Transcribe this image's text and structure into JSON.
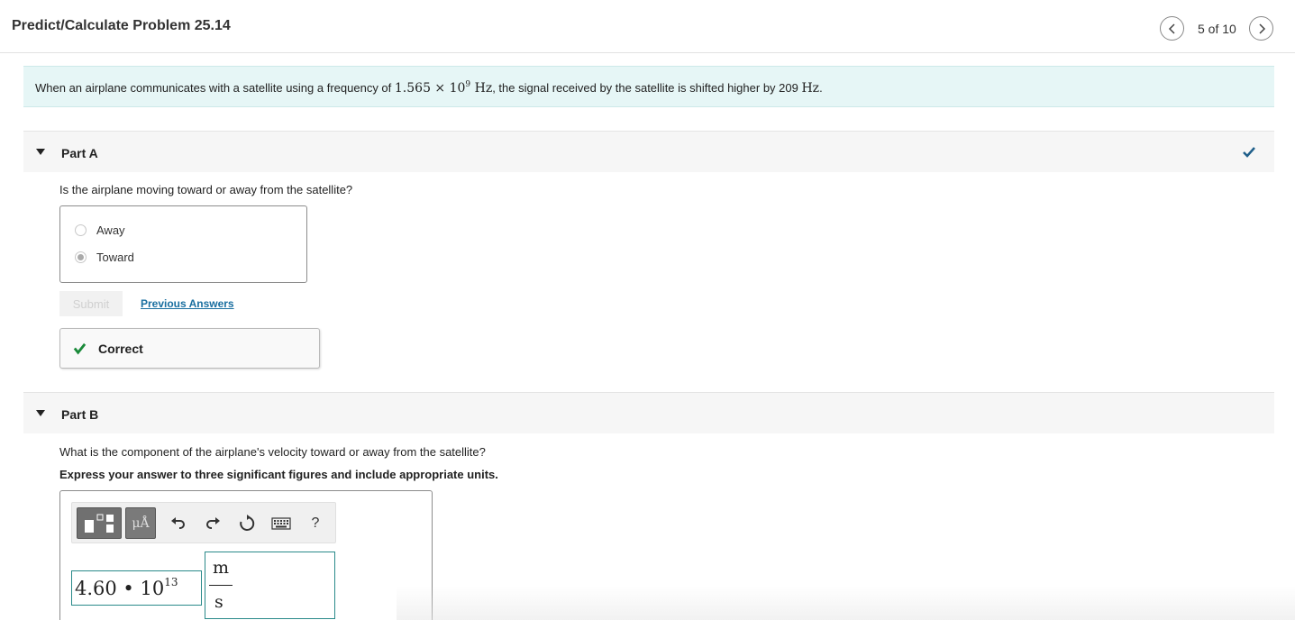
{
  "header": {
    "title": "Predict/Calculate Problem 25.14",
    "pager": "5 of 10"
  },
  "intro": {
    "text_before": "When an airplane communicates with a satellite using a frequency of ",
    "freq_mantissa": "1.565 × 10",
    "freq_exponent": "9",
    "freq_unit": " Hz",
    "text_middle": ", the signal received by the satellite is shifted higher by 209 ",
    "shift_unit": "Hz",
    "text_end": "."
  },
  "part_a": {
    "title": "Part A",
    "question": "Is the airplane moving toward or away from the satellite?",
    "choices": [
      {
        "label": "Away",
        "selected": false
      },
      {
        "label": "Toward",
        "selected": true
      }
    ],
    "submit_label": "Submit",
    "previous_answers_label": "Previous Answers",
    "feedback": "Correct"
  },
  "part_b": {
    "title": "Part B",
    "question": "What is the component of the airplane's velocity toward or away from the satellite?",
    "instruction": "Express your answer to three significant figures and include appropriate units.",
    "toolbar": {
      "units_label": "μÅ",
      "help_label": "?"
    },
    "answer_value_mantissa": "4.60 • 10",
    "answer_value_exponent": "13",
    "answer_unit_numerator": "m",
    "answer_unit_denominator": "s"
  },
  "colors": {
    "accent_teal": "#2a8a8a",
    "correct_green": "#1a8a3a",
    "check_blue": "#1f5f8a",
    "intro_bg": "#e6f6f6"
  }
}
